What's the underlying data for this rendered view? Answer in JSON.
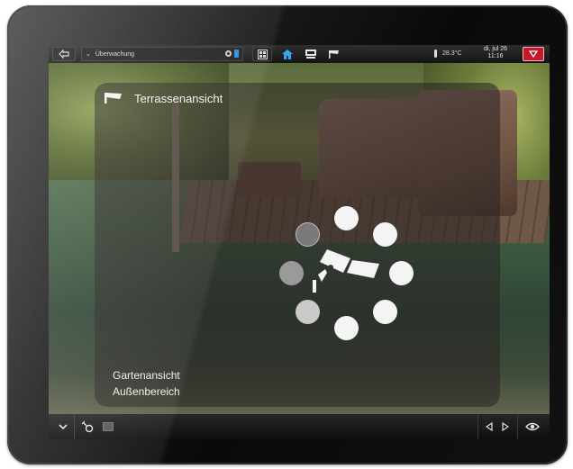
{
  "topbar": {
    "room_selector_label": "Überwachung",
    "temperature": "28.3°C",
    "date": "di, jul 26",
    "time": "11:16"
  },
  "camera_panel": {
    "title": "Terrassenansicht",
    "subtitle_line1": "Gartenansicht",
    "subtitle_line2": "Außenbereich"
  },
  "colors": {
    "alarm": "#c7172c",
    "active_blue": "#2b8fd8"
  },
  "icons": {
    "back": "back-arrow-icon",
    "dropdown": "chevron-down-icon",
    "settings": "gear-icon",
    "battery": "battery-icon",
    "grid": "grid-icon",
    "home": "home-icon",
    "screen": "monitor-icon",
    "camera": "camera-icon",
    "thermometer": "thermometer-icon",
    "alarm": "alarm-icon",
    "eye": "eye-icon"
  }
}
